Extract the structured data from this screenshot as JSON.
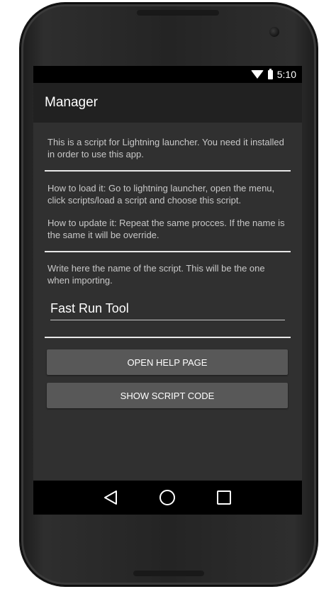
{
  "status_bar": {
    "time": "5:10",
    "icons": [
      "wifi-icon",
      "battery-icon"
    ]
  },
  "app_bar": {
    "title": "Manager"
  },
  "intro": {
    "text": "This is a script for Lightning launcher. You need it installed in order to use this app."
  },
  "instructions": {
    "load_text": "How to load it: Go to lightning launcher, open the menu, click scripts/load a script and choose this script.",
    "update_text": "How to update it: Repeat the same procces. If the name is the same it will be override."
  },
  "script_name": {
    "label": "Write here the name of the script. This will be the one when importing.",
    "value": "Fast Run Tool"
  },
  "buttons": {
    "help_label": "OPEN HELP PAGE",
    "code_label": "SHOW SCRIPT CODE"
  },
  "nav_bar": {
    "icons": [
      "back-icon",
      "home-icon",
      "recents-icon"
    ]
  },
  "colors": {
    "screen_bg": "#303030",
    "app_bar_bg": "#212121",
    "button_bg": "#585858",
    "divider": "#e8e8e8"
  }
}
